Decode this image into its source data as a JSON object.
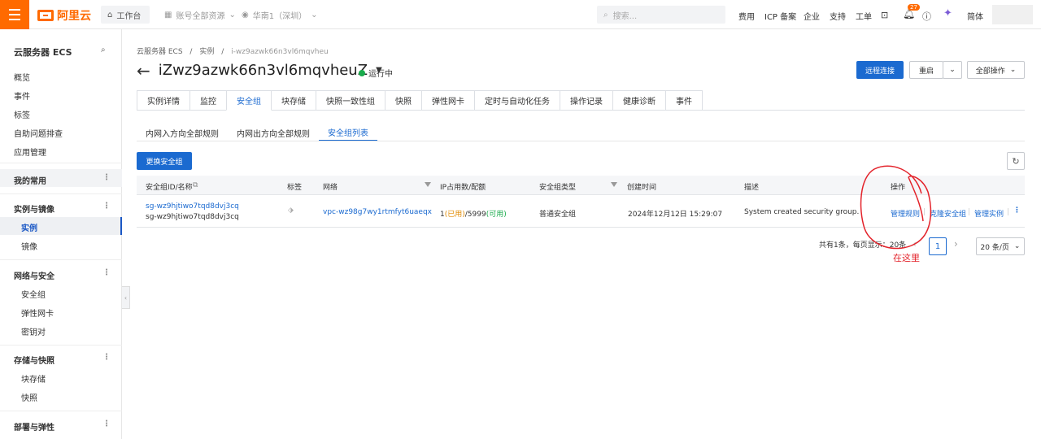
{
  "topbar": {
    "logo_text": "阿里云",
    "workspace": "工作台",
    "account_selector": "账号全部资源",
    "region_selector": "华南1（深圳）",
    "search_placeholder": "搜索...",
    "links": [
      "费用",
      "ICP 备案",
      "企业",
      "支持",
      "工单"
    ],
    "notification_count": "27",
    "language": "简体",
    "accent_color": "#ff6a00"
  },
  "sidebar": {
    "title": "云服务器 ECS",
    "top_items": [
      "概览",
      "事件",
      "标签",
      "自助问题排查",
      "应用管理"
    ],
    "favorites": "我的常用",
    "groups": [
      {
        "label": "实例与镜像",
        "items": [
          "实例",
          "镜像"
        ]
      },
      {
        "label": "网络与安全",
        "items": [
          "安全组",
          "弹性网卡",
          "密钥对"
        ]
      },
      {
        "label": "存储与快照",
        "items": [
          "块存储",
          "快照"
        ]
      },
      {
        "label": "部署与弹性",
        "items": []
      }
    ]
  },
  "breadcrumb": [
    "云服务器 ECS",
    "/",
    "实例",
    "/",
    "i-wz9azwk66n3vl6mqvheu"
  ],
  "instance": {
    "name": "iZwz9azwk66n3vl6mqvheuZ",
    "status": "运行中",
    "status_color": "#1aab4c"
  },
  "actions": {
    "remote_connect": "远程连接",
    "restart": "重启",
    "all_actions": "全部操作"
  },
  "tabs": [
    "实例详情",
    "监控",
    "安全组",
    "块存储",
    "快照一致性组",
    "快照",
    "弹性网卡",
    "定时与自动化任务",
    "操作记录",
    "健康诊断",
    "事件"
  ],
  "active_tab": "安全组",
  "subtabs": [
    "内网入方向全部规则",
    "内网出方向全部规则",
    "安全组列表"
  ],
  "active_subtab": "安全组列表",
  "change_sg_button": "更换安全组",
  "table": {
    "headers": [
      "安全组ID/名称",
      "标签",
      "网络",
      "IP占用数/配额",
      "安全组类型",
      "创建时间",
      "描述",
      "操作"
    ],
    "rows": [
      {
        "sg_id": "sg-wz9hjtiwo7tqd8dvj3cq",
        "sg_name": "sg-wz9hjtiwo7tqd8dvj3cq",
        "network": "vpc-wz98g7wy1rtmfyt6uaeqx",
        "ip_used": "1",
        "ip_used_label": "(已用)",
        "ip_quota": "/5999",
        "ip_avail_label": "(可用)",
        "sg_type": "普通安全组",
        "created": "2024年12月12日 15:29:07",
        "description": "System created security group.",
        "ops": [
          "管理规则",
          "克隆安全组",
          "管理实例"
        ]
      }
    ]
  },
  "pagination": {
    "summary": "共有1条，每页显示：20条",
    "current_page": "1",
    "page_size": "20 条/页"
  },
  "annotation": {
    "text": "在这里",
    "color": "#e3222a"
  }
}
